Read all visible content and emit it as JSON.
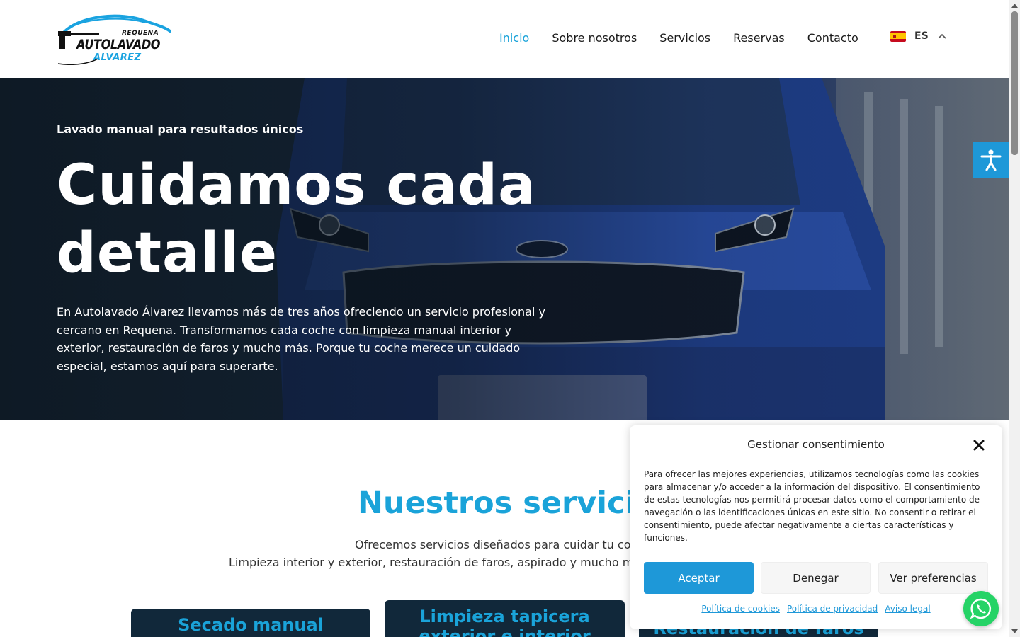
{
  "brand": {
    "small": "REQUENA",
    "main": "AUTOLAVADO",
    "sub": "ALVAREZ",
    "accent_color": "#1aa3d9"
  },
  "nav": {
    "items": [
      {
        "label": "Inicio",
        "active": true
      },
      {
        "label": "Sobre nosotros",
        "active": false
      },
      {
        "label": "Servicios",
        "active": false
      },
      {
        "label": "Reservas",
        "active": false
      },
      {
        "label": "Contacto",
        "active": false
      }
    ],
    "language": {
      "code": "ES",
      "flag_icon": "spain-flag-icon"
    }
  },
  "hero": {
    "kicker": "Lavado manual para resultados únicos",
    "title": "Cuidamos cada detalle",
    "text": "En Autolavado Álvarez llevamos más de tres años ofreciendo un servicio profesional y cercano en Requena. Transformamos cada coche con limpieza manual interior y exterior, restauración de faros y mucho más. Porque tu coche merece un cuidado especial, estamos aquí para superarte."
  },
  "services": {
    "title": "Nuestros servicio",
    "desc_line1": "Ofrecemos servicios diseñados para cuidar tu co",
    "desc_line2": "Limpieza interior y exterior, restauración de faros, aspirado y mucho m",
    "cards": [
      {
        "title": "Secado manual"
      },
      {
        "title": "Limpieza tapicera exterior e interior"
      },
      {
        "title": "Restauración de faros"
      }
    ]
  },
  "consent": {
    "title": "Gestionar consentimiento",
    "body": "Para ofrecer las mejores experiencias, utilizamos tecnologías como las cookies para almacenar y/o acceder a la información del dispositivo. El consentimiento de estas tecnologías nos permitirá procesar datos como el comportamiento de navegación o las identificaciones únicas en este sitio. No consentir o retirar el consentimiento, puede afectar negativamente a ciertas características y funciones.",
    "accept": "Aceptar",
    "deny": "Denegar",
    "preferences": "Ver preferencias",
    "links": [
      "Política de cookies",
      "Política de privacidad",
      "Aviso legal"
    ]
  }
}
